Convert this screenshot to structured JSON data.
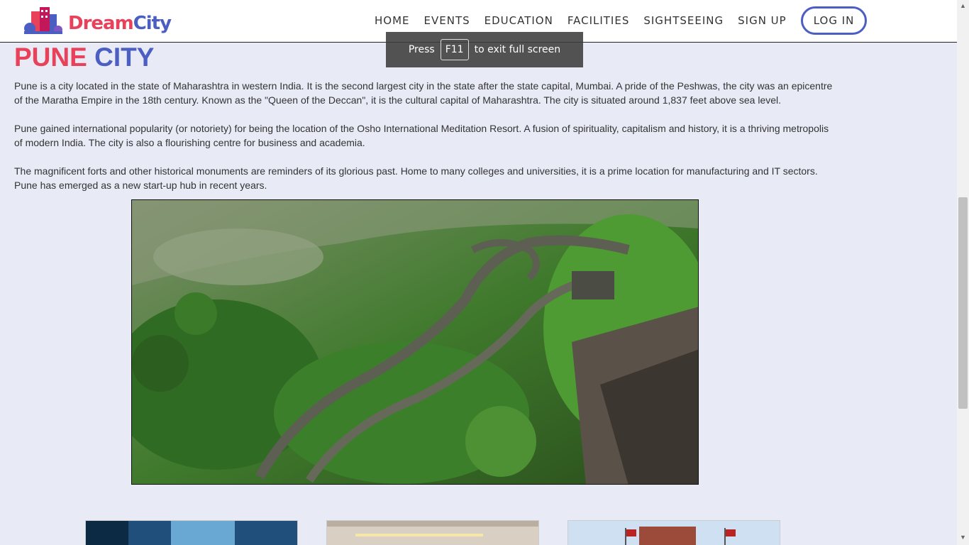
{
  "brand": {
    "part1": "Dream",
    "part2": "City"
  },
  "nav": {
    "items": [
      "HOME",
      "EVENTS",
      "EDUCATION",
      "FACILITIES",
      "SIGHTSEEING",
      "SIGN UP"
    ],
    "login": "LOG IN"
  },
  "toast": {
    "pre": "Press",
    "key": "F11",
    "post": "to exit full screen"
  },
  "page": {
    "title_part1": "PUNE",
    "title_part2": "CITY",
    "paragraphs": [
      "Pune is a city located in the state of Maharashtra in western India. It is the second largest city in the state after the state capital, Mumbai. A pride of the Peshwas, the city was an epicentre of the Maratha Empire in the 18th century. Known as the \"Queen of the Deccan\", it is the cultural capital of Maharashtra. The city is situated around 1,837 feet above sea level.",
      "Pune gained international popularity (or notoriety) for being the location of the Osho International Meditation Resort. A fusion of spirituality, capitalism and history, it is a thriving metropolis of modern India. The city is also a flourishing centre for business and academia.",
      "The magnificent forts and other historical monuments are reminders of its glorious past. Home to many colleges and universities, it is a prime location for manufacturing and IT sectors. Pune has emerged as a new start-up hub in recent years."
    ]
  },
  "colors": {
    "accent_red": "#e8415a",
    "accent_blue": "#4a5fc1",
    "background": "#e8eaf6"
  }
}
